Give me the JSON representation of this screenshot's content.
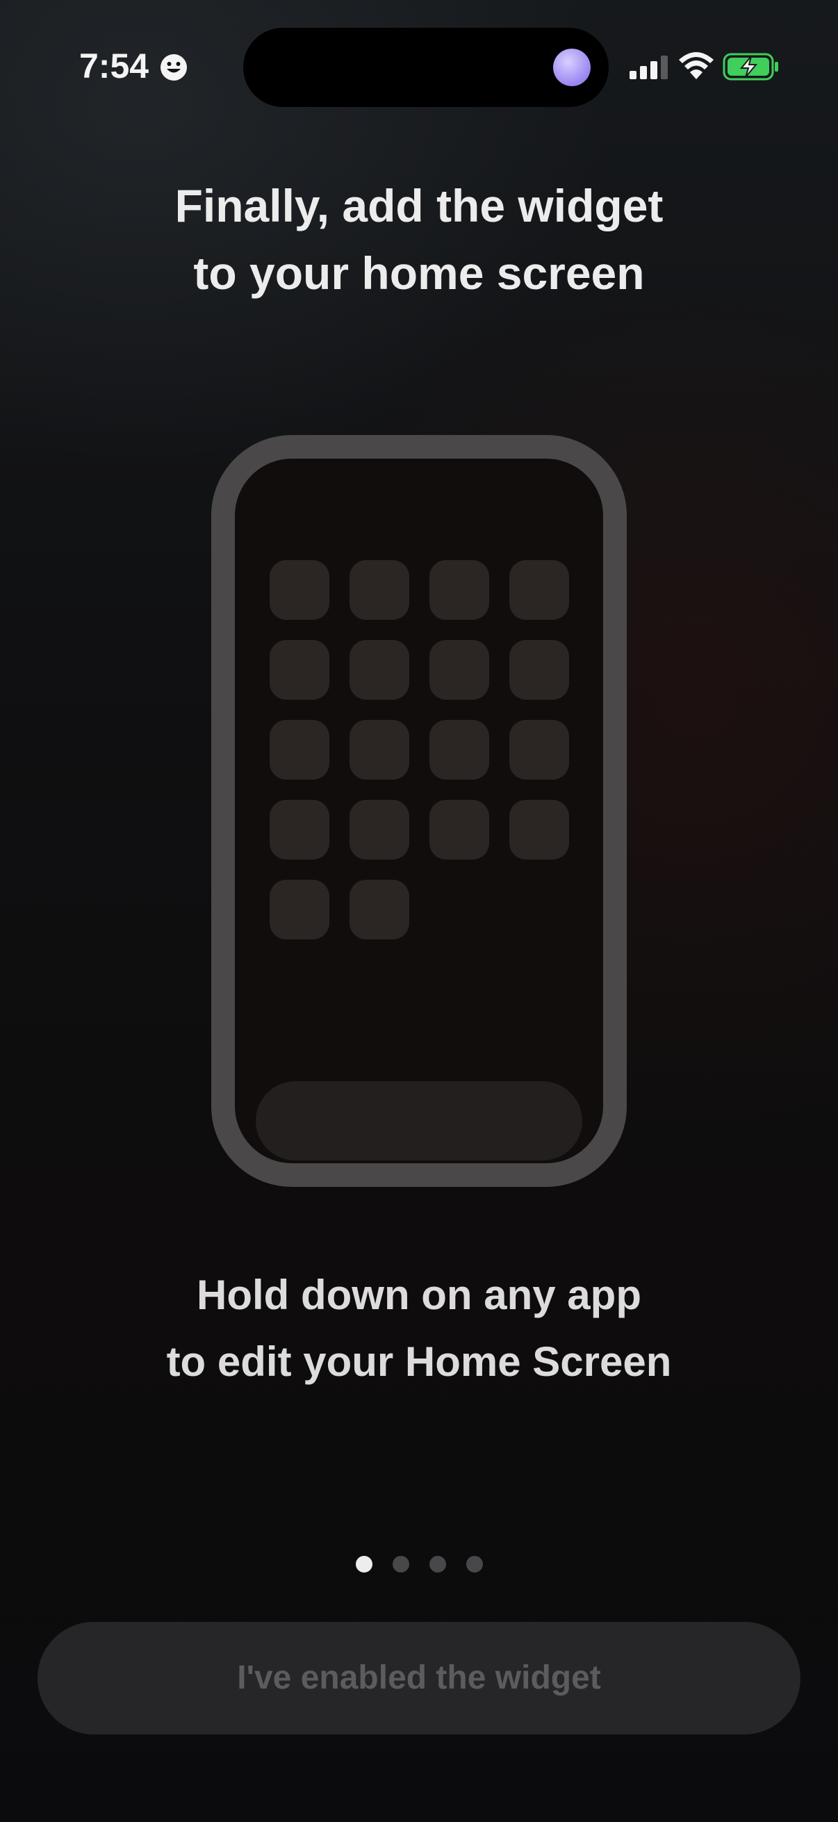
{
  "status_bar": {
    "time": "7:54",
    "icons": [
      "smiley-icon",
      "signal-icon",
      "wifi-icon",
      "battery-charging-icon"
    ]
  },
  "title": {
    "line1": "Finally, add the widget",
    "line2": "to your home screen"
  },
  "illustration": {
    "app_icon_count": 18,
    "colors": {
      "frame": "#4a4848",
      "screen": "#110d0d",
      "app_icon": "#2b2524",
      "dock": "#221f1e"
    }
  },
  "instruction": {
    "line1": "Hold down on any app",
    "line2": "to edit your Home Screen"
  },
  "pager": {
    "total": 4,
    "current": 1
  },
  "button": {
    "label": "I've enabled the widget",
    "enabled": false
  }
}
